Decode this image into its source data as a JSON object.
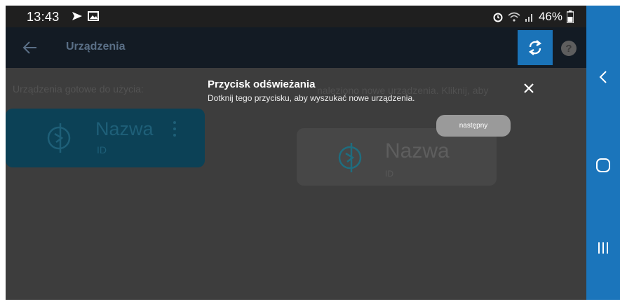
{
  "status_bar": {
    "time": "13:43",
    "battery": "46%"
  },
  "appbar": {
    "title": "Urządzenia",
    "help_label": "?"
  },
  "content": {
    "section_label": "Urządzenia gotowe do użycia:",
    "background_hint": "naleziono nowe urządzenia. Kliknij, aby",
    "device_card": {
      "name": "Nazwa",
      "id": "ID"
    },
    "new_device_card": {
      "name": "Nazwa",
      "id": "ID"
    }
  },
  "tooltip": {
    "title": "Przycisk odświeżania",
    "body": "Dotknij tego przycisku, aby wyszukać nowe urządzenia.",
    "next_label": "następny"
  },
  "colors": {
    "accent": "#1a73b8",
    "nav_bar": "#1b75bb",
    "card": "#0c4156",
    "overlay": "#3d3d3d"
  },
  "icons": {
    "back": "arrow-left-icon",
    "refresh": "refresh-icon",
    "help": "help-icon",
    "close": "close-icon",
    "device": "device-icon",
    "menu": "more-vertical-icon",
    "nav_back": "chevron-left-icon",
    "nav_home": "home-icon",
    "nav_recent": "recent-apps-icon"
  }
}
